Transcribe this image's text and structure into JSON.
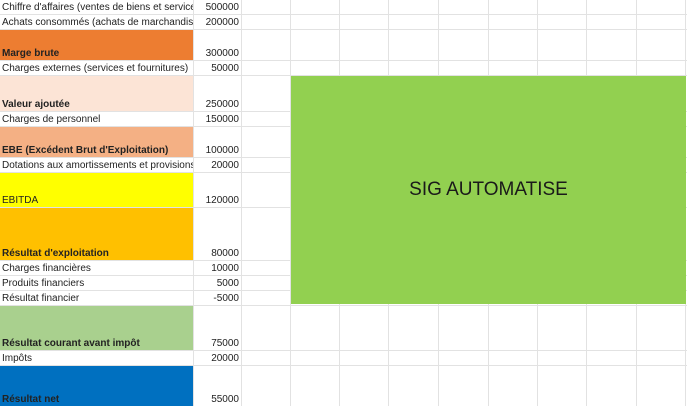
{
  "sheet": {
    "rows": [
      {
        "label": "Chiffre d'affaires (ventes de biens et services)",
        "value": "500000",
        "bold": false,
        "fill": ""
      },
      {
        "label": "Achats consommés (achats de marchandises)",
        "value": "200000",
        "bold": false,
        "fill": ""
      },
      {
        "label": "Marge brute",
        "value": "300000",
        "bold": true,
        "fill": "#ed7d31"
      },
      {
        "label": "Charges externes (services et fournitures)",
        "value": "50000",
        "bold": false,
        "fill": ""
      },
      {
        "label": "Valeur ajoutée",
        "value": "250000",
        "bold": true,
        "fill": "#fce4d6"
      },
      {
        "label": "Charges de personnel",
        "value": "150000",
        "bold": false,
        "fill": ""
      },
      {
        "label": "EBE (Excédent Brut d'Exploitation)",
        "value": "100000",
        "bold": true,
        "fill": "#f4b084"
      },
      {
        "label": "Dotations aux amortissements et provisions",
        "value": "20000",
        "bold": false,
        "fill": ""
      },
      {
        "label": "EBITDA",
        "value": "120000",
        "bold": false,
        "fill": "#ffff00"
      },
      {
        "label": "Résultat d'exploitation",
        "value": "80000",
        "bold": true,
        "fill": "#ffc000"
      },
      {
        "label": "Charges financières",
        "value": "10000",
        "bold": false,
        "fill": ""
      },
      {
        "label": "Produits financiers",
        "value": "5000",
        "bold": false,
        "fill": ""
      },
      {
        "label": "Résultat financier",
        "value": "-5000",
        "bold": false,
        "fill": ""
      },
      {
        "label": "Résultat courant avant impôt",
        "value": "75000",
        "bold": true,
        "fill": "#a9d08e"
      },
      {
        "label": "Impôts",
        "value": "20000",
        "bold": false,
        "fill": ""
      },
      {
        "label": "Résultat net",
        "value": "55000",
        "bold": true,
        "fill": "#0070c0"
      }
    ],
    "banner": {
      "text": "SIG AUTOMATISE",
      "fill": "#92d050"
    }
  }
}
